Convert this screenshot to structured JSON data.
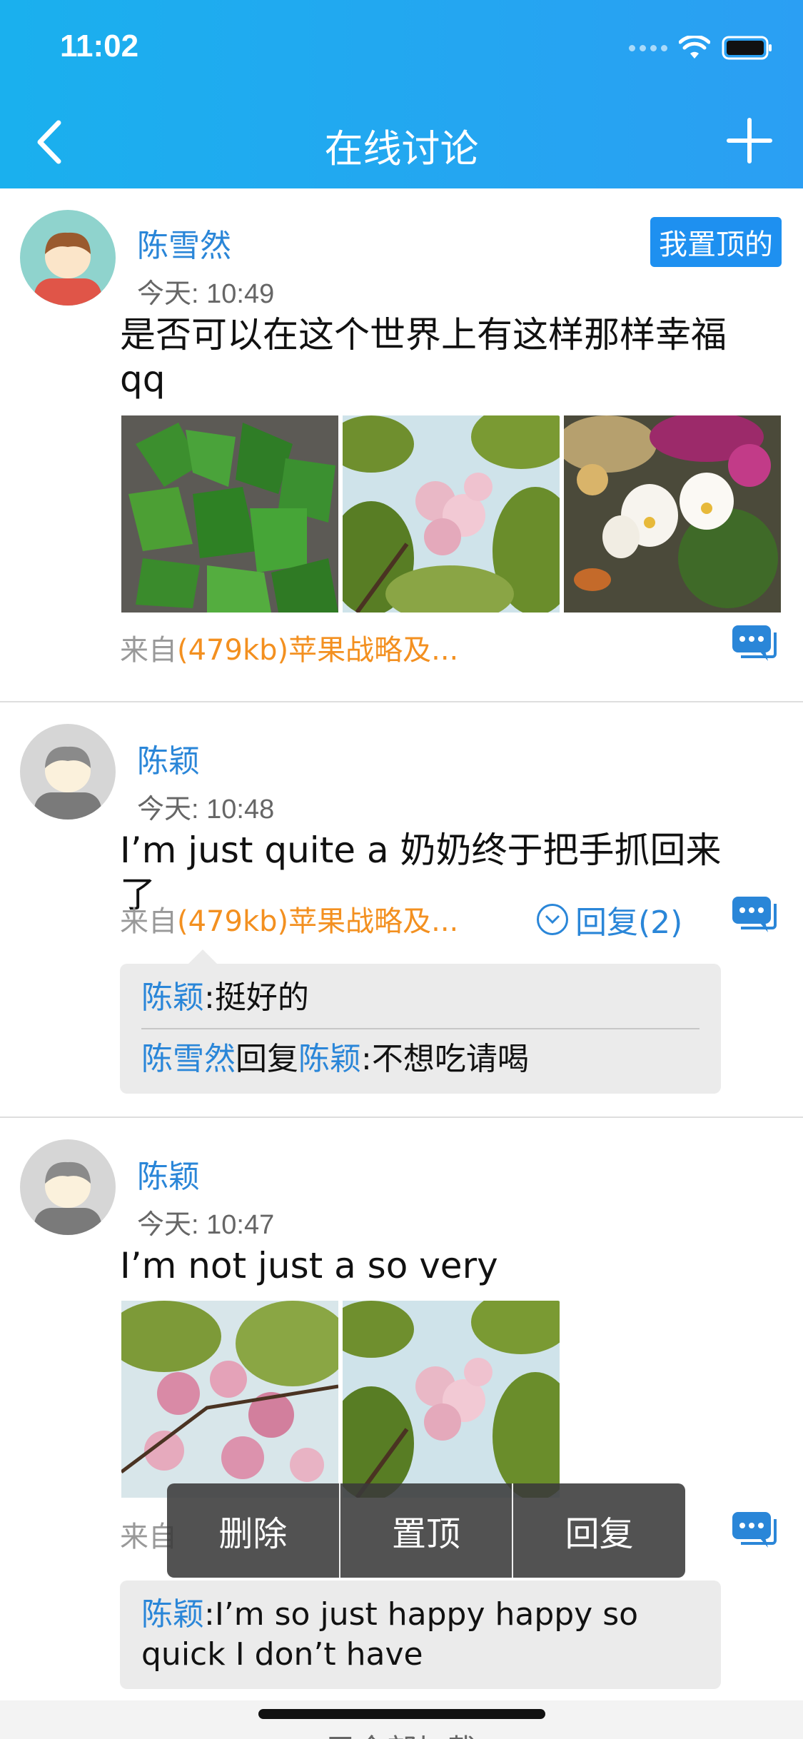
{
  "status": {
    "time": "11:02"
  },
  "header": {
    "title": "在线讨论",
    "back_icon": "back-chevron-icon",
    "add_icon": "plus-icon"
  },
  "posts": [
    {
      "author": "陈雪然",
      "time": "今天: 10:49",
      "content": "是否可以在这个世界上有这样那样幸福qq",
      "pin_badge": "我置顶的",
      "photos": [
        "zongzi",
        "cherry-blossom",
        "orchids"
      ],
      "source_prefix": "来自",
      "source_file": "(479kb)苹果战略及..."
    },
    {
      "author": "陈颖",
      "time": "今天: 10:48",
      "content": "I’m just quite a 奶奶终于把手抓回来了",
      "source_prefix": "来自",
      "source_file": "(479kb)苹果战略及...",
      "reply_count": "回复(2)",
      "comments": [
        {
          "name": "陈颖",
          "text": ":挺好的"
        },
        {
          "name": "陈雪然",
          "reply_word": "回复",
          "target": "陈颖",
          "text": ":不想吃请喝"
        }
      ]
    },
    {
      "author": "陈颖",
      "time": "今天: 10:47",
      "content": "I’m not just a so very",
      "photos": [
        "cherry-blossom-2",
        "cherry-blossom"
      ],
      "source_prefix": "来自",
      "comments": [
        {
          "name": "陈颖",
          "text": ":I’m so just happy happy so quick I don’t have"
        }
      ]
    }
  ],
  "action_menu": {
    "delete": "删除",
    "pin": "置顶",
    "reply": "回复"
  },
  "footer": {
    "text": "已全部加载"
  },
  "colors": {
    "header_start": "#1ab0ee",
    "header_end": "#2b9ff3",
    "name_blue": "#2a86d8",
    "file_orange": "#f39020",
    "badge_blue": "#1e90f0"
  }
}
